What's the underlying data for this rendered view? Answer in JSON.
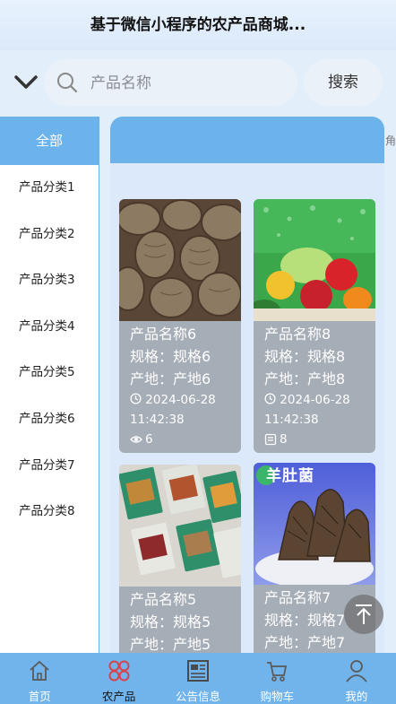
{
  "header": {
    "title": "基于微信小程序的农产品商城..."
  },
  "search": {
    "placeholder": "产品名称",
    "button_label": "搜索"
  },
  "sidebar": {
    "all_label": "全部",
    "items": [
      {
        "label": "产品分类1"
      },
      {
        "label": "产品分类2"
      },
      {
        "label": "产品分类3"
      },
      {
        "label": "产品分类4"
      },
      {
        "label": "产品分类5"
      },
      {
        "label": "产品分类6"
      },
      {
        "label": "产品分类7"
      },
      {
        "label": "产品分类8"
      }
    ]
  },
  "edge_text": "角⊙",
  "products": [
    {
      "name": "产品名称6",
      "spec": "规格：规格6",
      "origin": "产地：产地6",
      "time": "2024-06-28 11:42:38",
      "count": "6",
      "count_icon": "eye-icon"
    },
    {
      "name": "产品名称8",
      "spec": "规格：规格8",
      "origin": "产地：产地8",
      "time": "2024-06-28 11:42:38",
      "count": "8",
      "count_icon": "document-icon"
    },
    {
      "name": "产品名称5",
      "spec": "规格：规格5",
      "origin": "产地：产地5"
    },
    {
      "name": "产品名称7",
      "spec": "规格：规格7",
      "origin": "产地：产地7",
      "image_text": "羊肚菌"
    }
  ],
  "tabbar": {
    "items": [
      {
        "label": "首页",
        "icon": "home-icon"
      },
      {
        "label": "农产品",
        "icon": "grid-icon"
      },
      {
        "label": "公告信息",
        "icon": "news-icon"
      },
      {
        "label": "购物车",
        "icon": "cart-icon"
      },
      {
        "label": "我的",
        "icon": "user-icon"
      }
    ],
    "active": "农产品"
  },
  "colors": {
    "accent": "#6cb3ec",
    "card_body": "#a5adb6",
    "active_tab_icon": "#d9424a"
  }
}
